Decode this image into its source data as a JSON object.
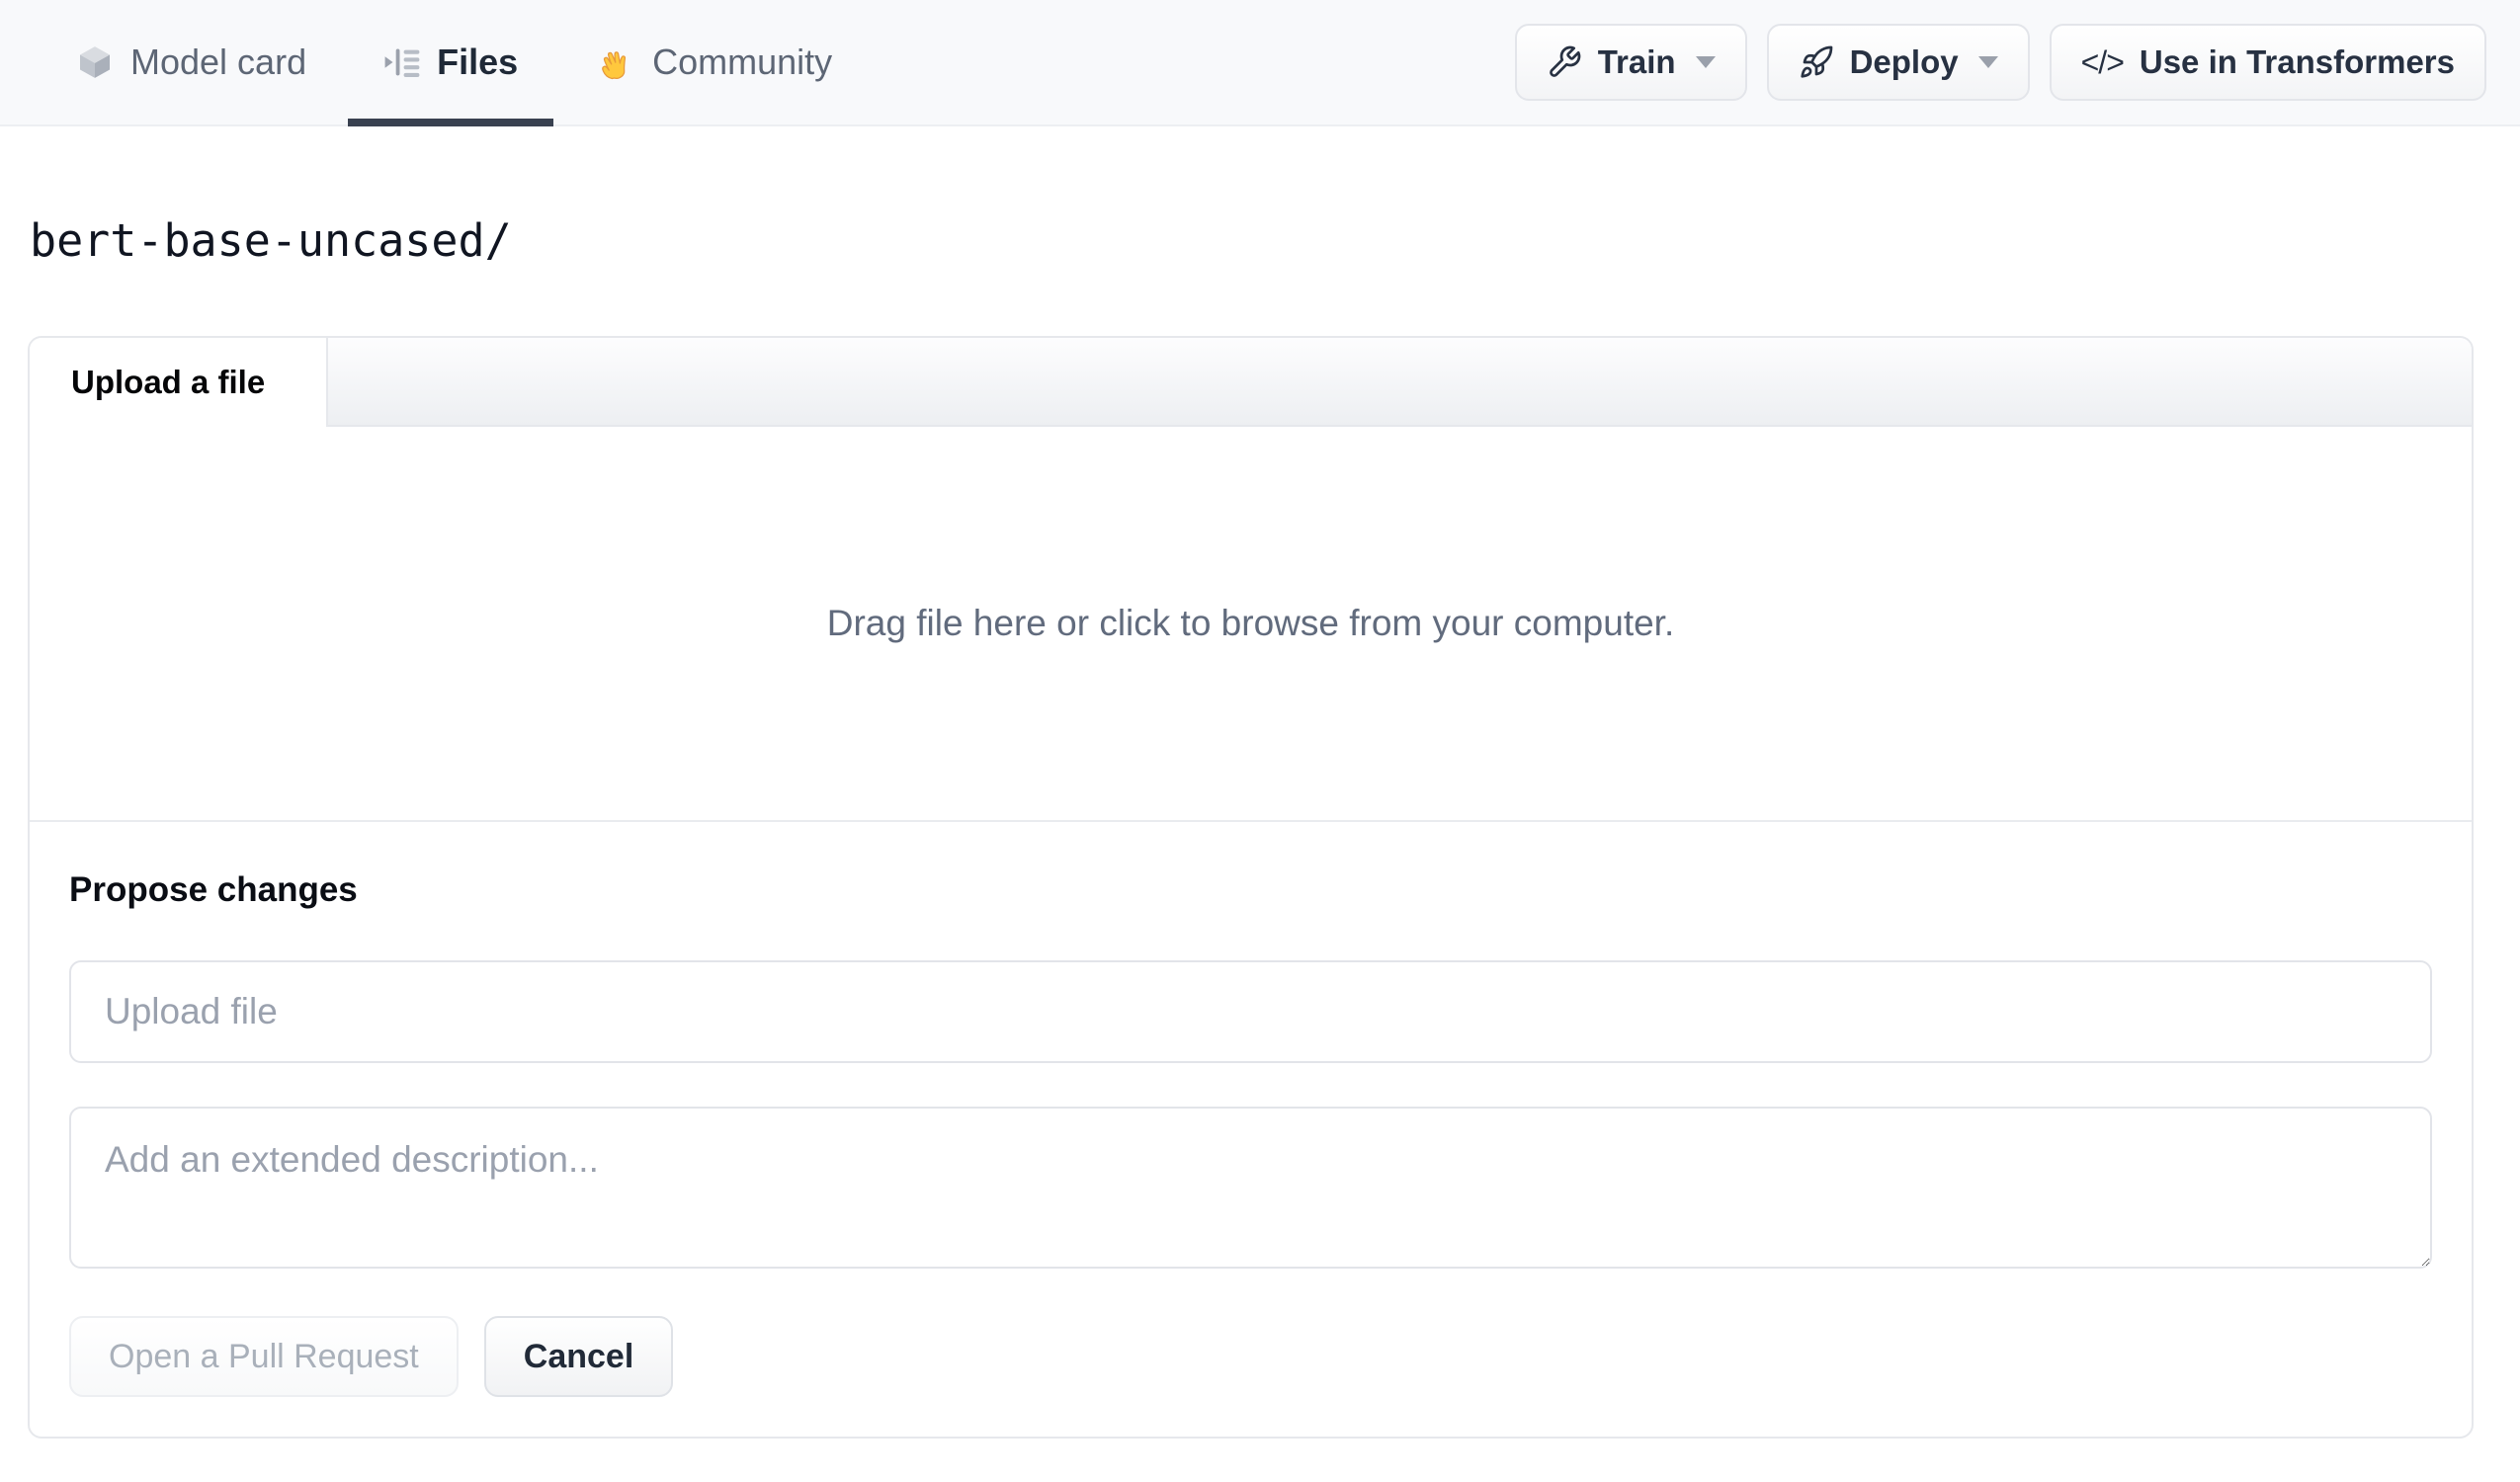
{
  "header": {
    "tabs": [
      {
        "label": "Model card",
        "icon": "cube-icon",
        "active": false
      },
      {
        "label": "Files",
        "icon": "versions-icon",
        "active": true
      },
      {
        "label": "Community",
        "icon": "waving-hand-icon",
        "active": false
      }
    ],
    "actions": [
      {
        "label": "Train",
        "icon": "wrench-icon",
        "has_dropdown": true
      },
      {
        "label": "Deploy",
        "icon": "rocket-icon",
        "has_dropdown": true
      },
      {
        "label": "Use in Transformers",
        "icon": "code-icon",
        "has_dropdown": false,
        "icon_glyph": "</>"
      }
    ]
  },
  "breadcrumb": {
    "path": "bert-base-uncased/"
  },
  "upload_panel": {
    "tab_label": "Upload a file",
    "dropzone_text": "Drag file here or click to browse from your computer.",
    "propose": {
      "title": "Propose changes",
      "filename_placeholder": "Upload file",
      "filename_value": "",
      "description_placeholder": "Add an extended description...",
      "description_value": "",
      "submit_label": "Open a Pull Request",
      "cancel_label": "Cancel"
    }
  },
  "colors": {
    "header_bg": "#f8f9fb",
    "active_tab_underline": "#394150",
    "panel_border": "#e6e8ec",
    "nav_text": "#5d6675",
    "active_text": "#1f2937",
    "muted_text": "#616b7d",
    "placeholder_text": "#9aa1ae",
    "disabled_text": "#a9b0ba",
    "hand_emoji_yellow": "#ffc83d"
  }
}
